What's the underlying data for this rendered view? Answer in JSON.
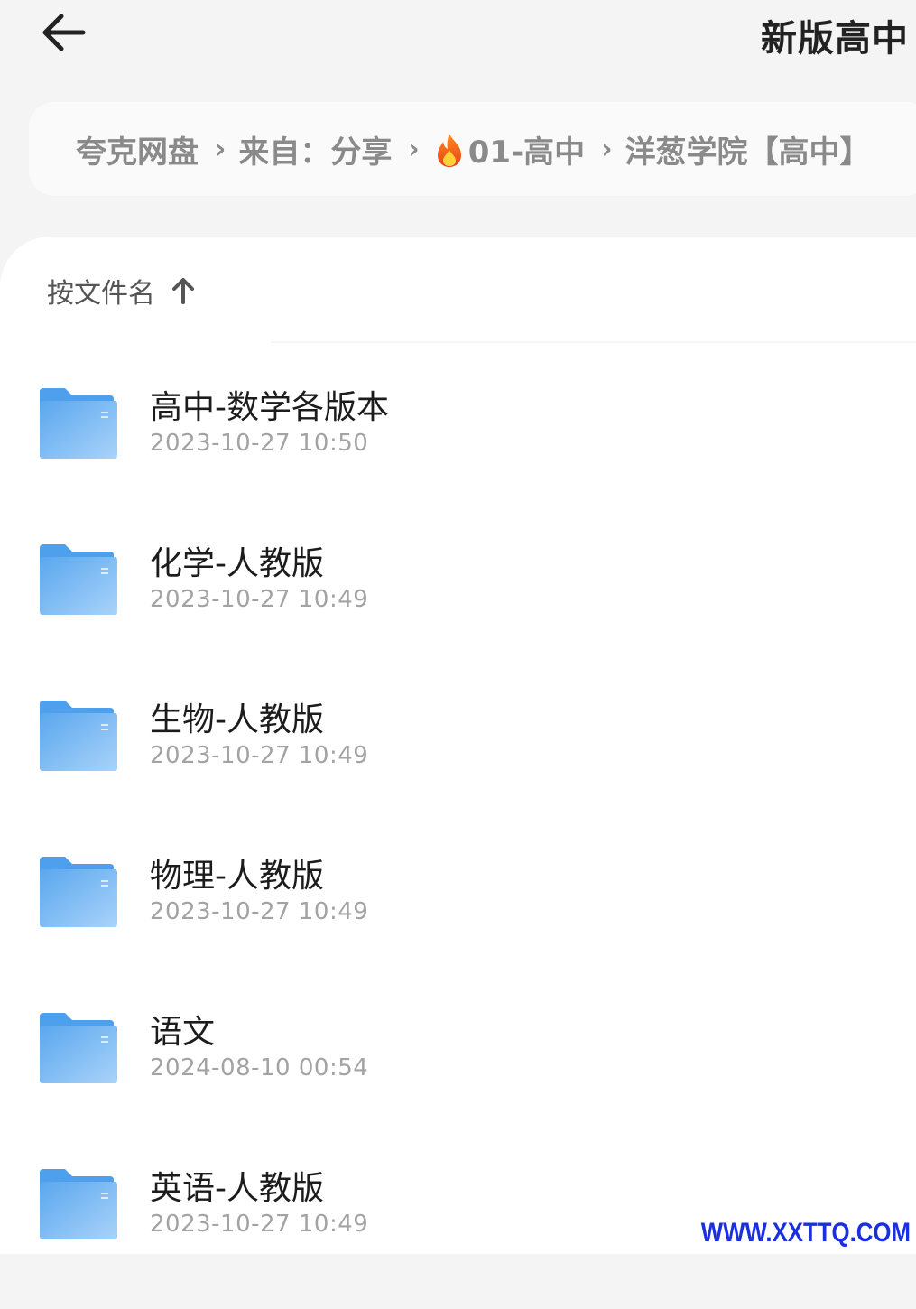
{
  "header": {
    "back_icon": "arrow-left-icon",
    "title": "新版高中"
  },
  "breadcrumb": {
    "items": [
      {
        "label": "夸克网盘"
      },
      {
        "label": "来自：分享"
      },
      {
        "label": "01-高中",
        "icon": "fire-icon"
      },
      {
        "label": "洋葱学院【高中】"
      }
    ],
    "separator_icon": "chevron-right-icon"
  },
  "sort": {
    "label": "按文件名",
    "direction_icon": "arrow-up-icon"
  },
  "files": [
    {
      "name": "高中-数学各版本",
      "date": "2023-10-27 10:50",
      "icon": "folder-icon"
    },
    {
      "name": "化学-人教版",
      "date": "2023-10-27 10:49",
      "icon": "folder-icon"
    },
    {
      "name": "生物-人教版",
      "date": "2023-10-27 10:49",
      "icon": "folder-icon"
    },
    {
      "name": "物理-人教版",
      "date": "2023-10-27 10:49",
      "icon": "folder-icon"
    },
    {
      "name": "语文",
      "date": "2024-08-10 00:54",
      "icon": "folder-icon"
    },
    {
      "name": "英语-人教版",
      "date": "2023-10-27 10:49",
      "icon": "folder-icon"
    }
  ],
  "watermark": "WWW.XXTTQ.COM",
  "colors": {
    "background": "#f4f4f4",
    "panel": "#ffffff",
    "folder_blue": "#64aef0",
    "watermark": "#1a2fe0"
  }
}
